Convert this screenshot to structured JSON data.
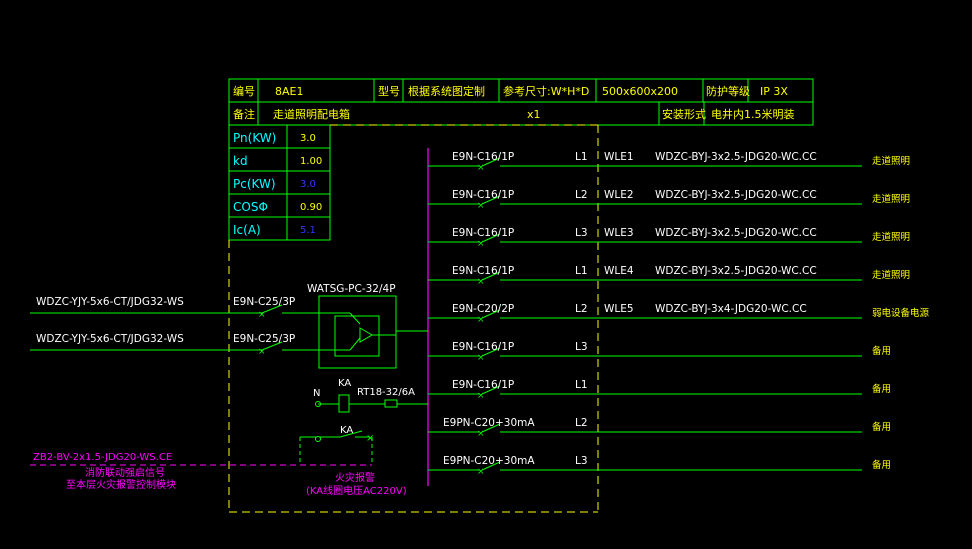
{
  "colors": {
    "background": "#000000",
    "frame": "#00ff00",
    "table_text": "#ffff00",
    "param_label": "#00ffff",
    "param_value": "#ffff00",
    "param_value_alt": "#3333ff",
    "busbar": "#ff00ff",
    "feeder_line": "#00ff00",
    "label_white": "#ffffff",
    "dashed_outline": "#ffff00",
    "control_magenta": "#ff00ff",
    "control_note": "#ff00ff"
  },
  "header": {
    "row1": [
      {
        "label": "编号",
        "value": "8AE1"
      },
      {
        "label": "型号",
        "value": "根据系统图定制"
      },
      {
        "label": "参考尺寸:W*H*D",
        "value": "500x600x200"
      },
      {
        "label": "防护等级",
        "value": "IP 3X"
      }
    ],
    "row2": {
      "label": "备注",
      "value": "走道照明配电箱",
      "qty": "x1",
      "install_label": "安装形式",
      "install_value": "电井内1.5米明装"
    }
  },
  "params": [
    {
      "label": "Pn(KW)",
      "value": "3.0",
      "alt": false
    },
    {
      "label": "kd",
      "value": "1.00",
      "alt": false
    },
    {
      "label": "Pc(KW)",
      "value": "3.0",
      "alt": true
    },
    {
      "label": "COSΦ",
      "value": "0.90",
      "alt": false
    },
    {
      "label": "Ic(A)",
      "value": "5.1",
      "alt": true
    }
  ],
  "incomers": [
    {
      "cable": "WDZC-YJY-5x6-CT/JDG32-WS",
      "breaker": "E9N-C25/3P"
    },
    {
      "cable": "WDZC-YJY-5x6-CT/JDG32-WS",
      "breaker": "E9N-C25/3P"
    }
  ],
  "ats_label": "WATSG-PC-32/4P",
  "feeders": [
    {
      "breaker": "E9N-C16/1P",
      "phase": "L1",
      "circuit": "WLE1",
      "cable": "WDZC-BYJ-3x2.5-JDG20-WC.CC",
      "use": "走道照明"
    },
    {
      "breaker": "E9N-C16/1P",
      "phase": "L2",
      "circuit": "WLE2",
      "cable": "WDZC-BYJ-3x2.5-JDG20-WC.CC",
      "use": "走道照明"
    },
    {
      "breaker": "E9N-C16/1P",
      "phase": "L3",
      "circuit": "WLE3",
      "cable": "WDZC-BYJ-3x2.5-JDG20-WC.CC",
      "use": "走道照明"
    },
    {
      "breaker": "E9N-C16/1P",
      "phase": "L1",
      "circuit": "WLE4",
      "cable": "WDZC-BYJ-3x2.5-JDG20-WC.CC",
      "use": "走道照明"
    },
    {
      "breaker": "E9N-C20/2P",
      "phase": "L2",
      "circuit": "WLE5",
      "cable": "WDZC-BYJ-3x4-JDG20-WC.CC",
      "use": "弱电设备电源"
    },
    {
      "breaker": "E9N-C16/1P",
      "phase": "L3",
      "circuit": "",
      "cable": "",
      "use": "备用"
    },
    {
      "breaker": "E9N-C16/1P",
      "phase": "L1",
      "circuit": "",
      "cable": "",
      "use": "备用"
    },
    {
      "breaker": "E9PN-C20+30mA",
      "phase": "L2",
      "circuit": "",
      "cable": "",
      "use": "备用"
    },
    {
      "breaker": "E9PN-C20+30mA",
      "phase": "L3",
      "circuit": "",
      "cable": "",
      "use": "备用"
    }
  ],
  "control": {
    "n_label": "N",
    "ka_label": "KA",
    "ka2_label": "KA",
    "fuse_label": "RT18-32/6A",
    "cable": "ZB2-BV-2x1.5-JDG20-WS.CE",
    "note1": "消防联动强启信号",
    "note2": "至本层火灾报警控制模块",
    "box_note1": "火灾报警",
    "box_note2": "(KA线圈电压AC220V)"
  }
}
